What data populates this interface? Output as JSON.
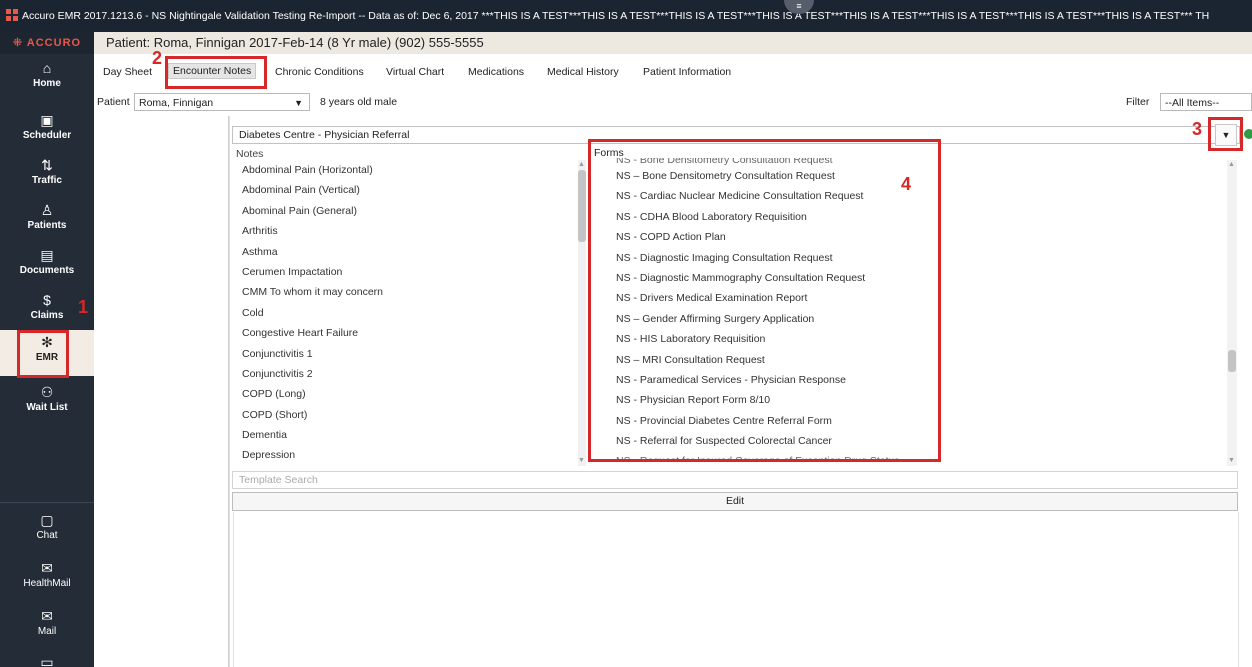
{
  "window": {
    "title": "Accuro EMR 2017.1213.6 - NS Nightingale Validation Testing Re-Import -- Data as of: Dec 6, 2017 ***THIS IS A TEST***THIS IS A TEST***THIS IS A TEST***THIS IS A TEST***THIS IS A TEST***THIS IS A TEST***THIS IS A TEST***THIS IS A TEST*** TH",
    "notch_icon": "≡"
  },
  "brand": "ACCURO",
  "sidebar": {
    "items": [
      {
        "label": "Home",
        "icon": "⌂",
        "icon_name": "home-icon"
      },
      {
        "label": "Scheduler",
        "icon": "▣",
        "icon_name": "calendar-icon"
      },
      {
        "label": "Traffic",
        "icon": "⇅",
        "icon_name": "traffic-icon"
      },
      {
        "label": "Patients",
        "icon": "♙",
        "icon_name": "person-icon"
      },
      {
        "label": "Documents",
        "icon": "▤",
        "icon_name": "document-icon"
      },
      {
        "label": "Claims",
        "icon": "$",
        "icon_name": "dollar-icon"
      },
      {
        "label": "EMR",
        "icon": "✻",
        "icon_name": "emr-icon"
      },
      {
        "label": "Wait List",
        "icon": "⚇",
        "icon_name": "group-icon"
      }
    ],
    "bottom": [
      {
        "label": "Chat",
        "icon": "▢",
        "icon_name": "chat-icon"
      },
      {
        "label": "HealthMail",
        "icon": "✉",
        "icon_name": "healthmail-icon"
      },
      {
        "label": "Mail",
        "icon": "✉",
        "icon_name": "mail-icon"
      },
      {
        "label": "",
        "icon": "▭",
        "icon_name": "more-icon"
      }
    ]
  },
  "patient_header": "Patient: Roma, Finnigan 2017-Feb-14 (8 Yr male) (902) 555-5555",
  "tabs": [
    "Day Sheet",
    "Encounter Notes",
    "Chronic Conditions",
    "Virtual Chart",
    "Medications",
    "Medical History",
    "Patient Information"
  ],
  "patient_row": {
    "label": "Patient",
    "value": "Roma, Finnigan",
    "age": "8 years old male",
    "filter_label": "Filter",
    "filter_value": "--All Items--"
  },
  "template_select": "Diabetes Centre - Physician Referral",
  "notes": {
    "header": "Notes",
    "items": [
      "Abdominal Pain (Horizontal)",
      "Abdominal Pain (Vertical)",
      "Abominal Pain (General)",
      "Arthritis",
      "Asthma",
      "Cerumen Impactation",
      "CMM To whom it may concern",
      "Cold",
      "Congestive Heart Failure",
      "Conjunctivitis 1",
      "Conjunctivitis 2",
      "COPD (Long)",
      "COPD (Short)",
      "Dementia",
      "Depression"
    ]
  },
  "forms": {
    "header": "Forms",
    "clipped_top": "NS - Bone Densitometry Consultation Request",
    "items": [
      "NS – Bone Densitometry Consultation Request",
      "NS - Cardiac Nuclear Medicine Consultation Request",
      "NS - CDHA Blood Laboratory Requisition",
      "NS - COPD Action Plan",
      "NS - Diagnostic Imaging Consultation Request",
      "NS - Diagnostic Mammography Consultation Request",
      "NS - Drivers Medical Examination Report",
      "NS – Gender Affirming Surgery Application",
      "NS - HIS Laboratory Requisition",
      "NS – MRI Consultation Request",
      "NS - Paramedical Services - Physician Response",
      "NS - Physician Report Form 8/10",
      "NS - Provincial Diabetes Centre Referral Form",
      "NS - Referral for Suspected Colorectal Cancer"
    ],
    "clipped_bottom": "NS - Request for Insured Coverage of Exception Drug Status"
  },
  "template_search_placeholder": "Template Search",
  "edit_label": "Edit",
  "annotations": [
    "1",
    "2",
    "3",
    "4"
  ],
  "colors": {
    "accent": "#d62828",
    "sidebar": "#232c37",
    "brand": "#e8574a"
  }
}
